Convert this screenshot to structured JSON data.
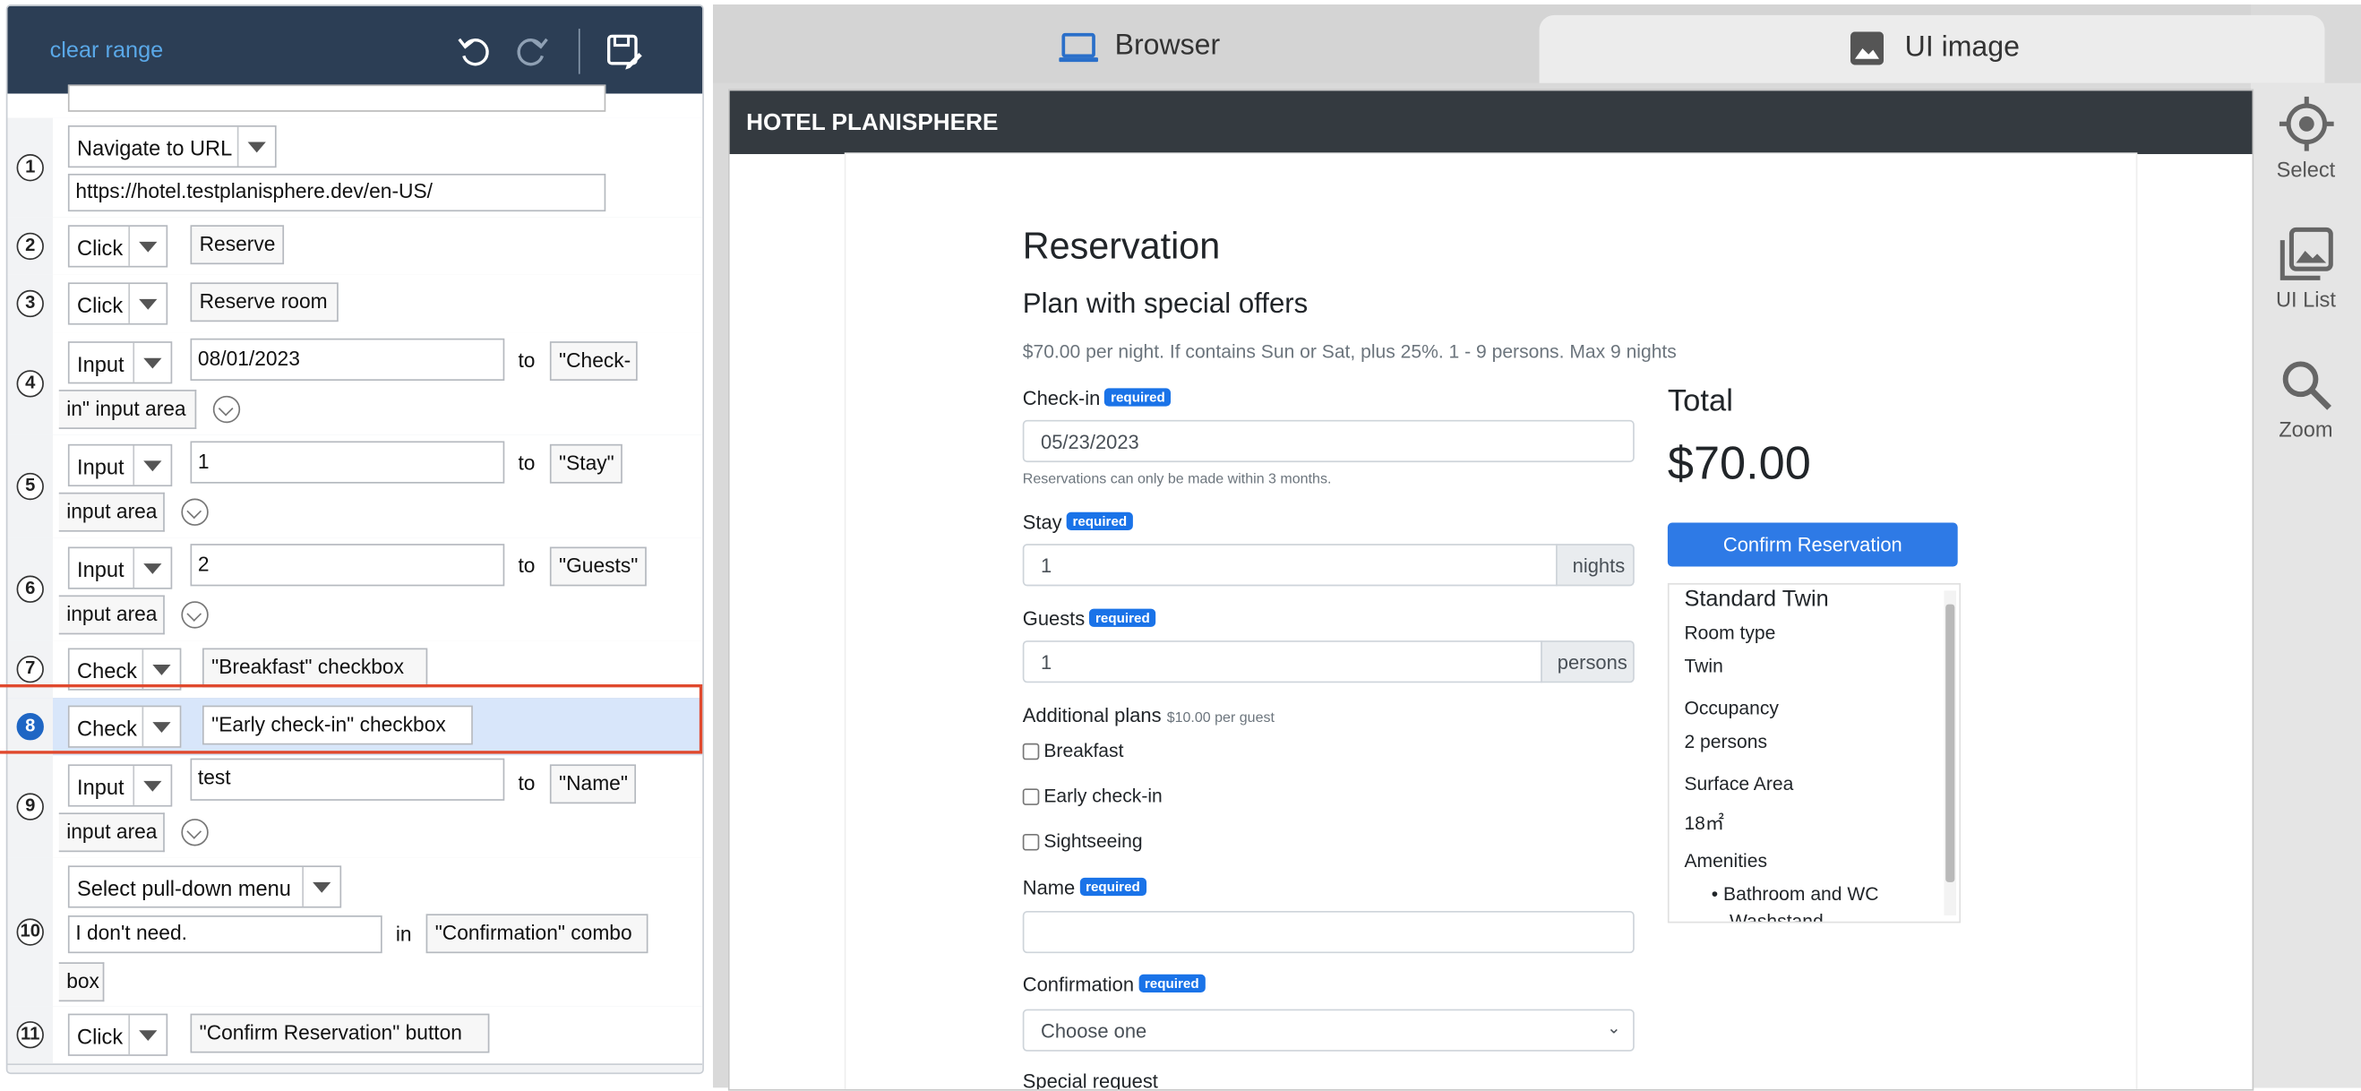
{
  "left_panel": {
    "header": {
      "clear_range": "clear range"
    },
    "steps": [
      {
        "num": "1",
        "action": "Navigate to URL",
        "value": "https://hotel.testplanisphere.dev/en-US/"
      },
      {
        "num": "2",
        "action": "Click",
        "target": "Reserve"
      },
      {
        "num": "3",
        "action": "Click",
        "target": "Reserve room"
      },
      {
        "num": "4",
        "action": "Input",
        "value": "08/01/2023",
        "to": "to",
        "target_a": "\"Check-",
        "target_b": "in\" input area"
      },
      {
        "num": "5",
        "action": "Input",
        "value": "1",
        "to": "to",
        "target_a": "\"Stay\"",
        "target_b": "input area"
      },
      {
        "num": "6",
        "action": "Input",
        "value": "2",
        "to": "to",
        "target_a": "\"Guests\"",
        "target_b": "input area"
      },
      {
        "num": "7",
        "action": "Check",
        "target": "\"Breakfast\" checkbox"
      },
      {
        "num": "8",
        "action": "Check",
        "target": "\"Early check-in\" checkbox"
      },
      {
        "num": "9",
        "action": "Input",
        "value": "test",
        "to": "to",
        "target_a": "\"Name\"",
        "target_b": "input area"
      },
      {
        "num": "10",
        "action": "Select pull-down menu",
        "value": "I don't need.",
        "in": "in",
        "target_a": "\"Confirmation\" combo",
        "target_b": "box"
      },
      {
        "num": "11",
        "action": "Click",
        "target": "\"Confirm Reservation\" button"
      }
    ],
    "selected_step": "8",
    "selection_color": "#e0492e",
    "accent_color": "#1f66c4"
  },
  "tabs": {
    "browser": "Browser",
    "ui_image": "UI image"
  },
  "sidebar": {
    "select": "Select",
    "ui_list": "UI List",
    "zoom": "Zoom"
  },
  "site": {
    "brand": "HOTEL PLANISPHERE",
    "heading": "Reservation",
    "plan": "Plan with special offers",
    "plan_desc": "$70.00 per night. If contains Sun or Sat, plus 25%. 1 - 9 persons. Max 9 nights",
    "required": "required",
    "checkin_label": "Check-in",
    "checkin_value": "05/23/2023",
    "checkin_help": "Reservations can only be made within 3 months.",
    "stay_label": "Stay",
    "stay_value": "1",
    "stay_unit": "nights",
    "guests_label": "Guests",
    "guests_value": "1",
    "guests_unit": "persons",
    "additional_label": "Additional plans",
    "additional_note": "$10.00 per guest",
    "plans": [
      "Breakfast",
      "Early check-in",
      "Sightseeing"
    ],
    "name_label": "Name",
    "confirmation_label": "Confirmation",
    "confirmation_value": "Choose one",
    "special_request": "Special request",
    "total_label": "Total",
    "total_value": "$70.00",
    "confirm_button": "Confirm Reservation",
    "room": {
      "name": "Standard Twin",
      "type_label": "Room type",
      "type_value": "Twin",
      "occupancy_label": "Occupancy",
      "occupancy_value": "2 persons",
      "area_label": "Surface Area",
      "area_value": "18㎡",
      "amenities_label": "Amenities",
      "amenity_1": "Bathroom and WC",
      "amenity_2": "Washstand"
    }
  }
}
